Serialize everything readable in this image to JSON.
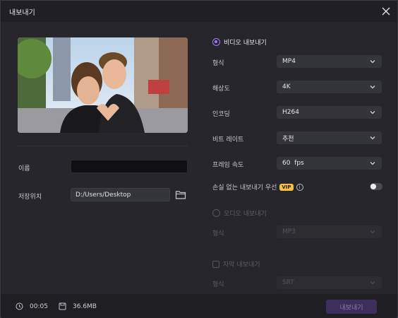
{
  "window": {
    "title": "내보내기"
  },
  "left": {
    "name_label": "이름",
    "name_value": "",
    "location_label": "저장위치",
    "location_value": "D:/Users/Desktop"
  },
  "video": {
    "section_label": "비디오 내보내기",
    "rows": [
      {
        "label": "형식",
        "value": "MP4"
      },
      {
        "label": "해상도",
        "value": "4K"
      },
      {
        "label": "인코딩",
        "value": "H264"
      },
      {
        "label": "비트 레이트",
        "value": "추천"
      },
      {
        "label": "프레임 속도",
        "value": "60  fps"
      }
    ],
    "lossless_label": "손실 없는 내보내기 우선",
    "vip_badge": "VIP",
    "info_glyph": "i"
  },
  "audio": {
    "section_label": "오디오 내보내기",
    "format_label": "형식",
    "format_value": "MP3"
  },
  "subtitle": {
    "section_label": "자막 내보내기",
    "format_label": "형식",
    "format_value": "SRT"
  },
  "footer": {
    "duration": "00:05",
    "size": "36.6MB",
    "export_label": "내보내기"
  },
  "colors": {
    "accent": "#a575ff",
    "vip": "#f5c043",
    "export_btn": "#3d2f5a"
  }
}
